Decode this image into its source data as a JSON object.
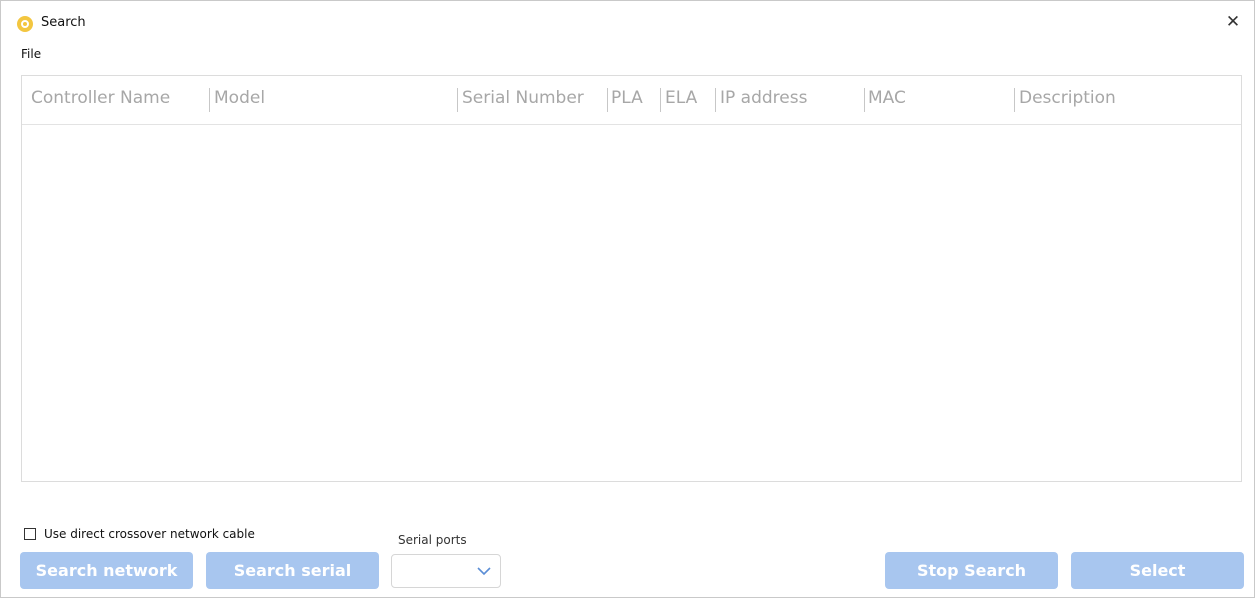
{
  "window": {
    "title": "Search",
    "close_glyph": "✕"
  },
  "menu": {
    "file": "File"
  },
  "table": {
    "columns": [
      "Controller Name",
      "Model",
      "Serial Number",
      "PLA",
      "ELA",
      "IP address",
      "MAC",
      "Description"
    ],
    "rows": []
  },
  "options": {
    "crossover_label": "Use direct crossover network cable",
    "crossover_checked": false
  },
  "serial": {
    "label": "Serial ports",
    "selected": ""
  },
  "buttons": {
    "search_network": "Search network",
    "search_serial": "Search serial",
    "stop_search": "Stop Search",
    "select": "Select"
  },
  "colors": {
    "button_disabled": "#a8c6ef",
    "app_icon": "#f3c640",
    "header_text": "#a7a7a7"
  },
  "icons": {
    "app": "gear-icon",
    "close": "close-icon",
    "dropdown": "chevron-down-icon"
  }
}
